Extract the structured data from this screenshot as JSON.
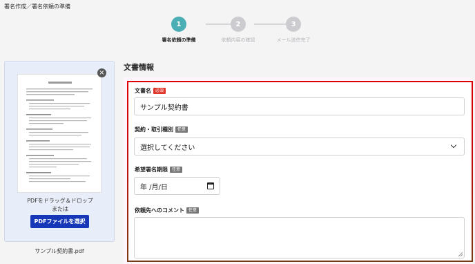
{
  "breadcrumb": "署名作成／署名依頼の準備",
  "stepper": {
    "steps": [
      {
        "number": "1",
        "label": "署名依頼の準備",
        "state": "active"
      },
      {
        "number": "2",
        "label": "依頼内容の確認",
        "state": "inactive"
      },
      {
        "number": "3",
        "label": "メール送信完了",
        "state": "inactive"
      }
    ]
  },
  "preview": {
    "close_icon": "×",
    "drop_text_line1": "PDFをドラッグ＆ドロップ",
    "drop_text_line2": "または",
    "select_button": "PDFファイルを選択",
    "file_name": "サンプル契約書.pdf"
  },
  "form": {
    "section_title": "文書情報",
    "required_badge": "必須",
    "optional_badge": "任意",
    "document_name": {
      "label": "文書名",
      "value": "サンプル契約書"
    },
    "contract_type": {
      "label": "契約・取引種別",
      "value": "選択してください"
    },
    "due_date": {
      "label": "希望署名期限",
      "value": "年 /月/日"
    },
    "comment": {
      "label": "依頼先へのコメント",
      "value": ""
    }
  },
  "colors": {
    "accent_step": "#4aaeb4",
    "primary_button": "#1637b8",
    "required_badge": "#e0352b",
    "optional_badge": "#777777",
    "highlight_border": "#e00000"
  }
}
